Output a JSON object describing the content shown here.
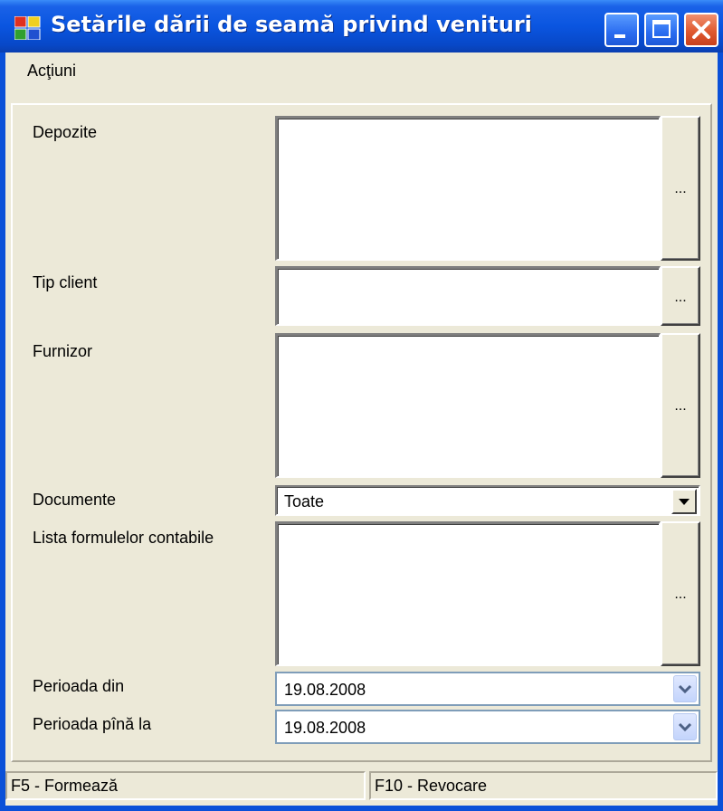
{
  "window": {
    "title": "Setările dării de seamă privind venituri"
  },
  "menu": {
    "actions": "Acţiuni"
  },
  "form": {
    "depozite_label": "Depozite",
    "tip_client_label": "Tip client",
    "furnizor_label": "Furnizor",
    "documente_label": "Documente",
    "documente_value": "Toate",
    "formule_label": "Lista formulelor contabile",
    "perioada_din_label": "Perioada din",
    "perioada_din_value": "19.08.2008",
    "perioada_pana_label": "Perioada pînă la",
    "perioada_pana_value": "19.08.2008",
    "ellipsis": "..."
  },
  "status": {
    "f5": "F5 - Formează",
    "f10": "F10 - Revocare"
  }
}
